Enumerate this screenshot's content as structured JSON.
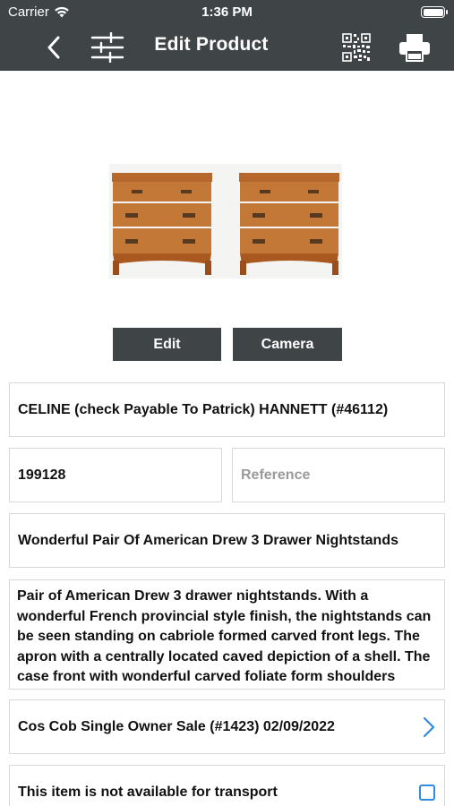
{
  "status_bar": {
    "carrier": "Carrier",
    "time": "1:36 PM",
    "battery_level": 1.0
  },
  "nav": {
    "title": "Edit Product",
    "back_icon": "chevron-left-icon",
    "filter_icon": "sliders-icon",
    "qr_icon": "qr-code-icon",
    "print_icon": "printer-icon"
  },
  "image": {
    "alt": "Pair of nightstands"
  },
  "buttons": {
    "edit": "Edit",
    "camera": "Camera"
  },
  "form": {
    "consignor": "CELINE (check Payable To Patrick) HANNETT (#46112)",
    "item_number": "199128",
    "reference_placeholder": "Reference",
    "title": "Wonderful Pair Of American Drew 3 Drawer Nightstands",
    "description": "Pair of American Drew 3 drawer nightstands.  With a wonderful French provincial style finish, the nightstands can be seen standing on cabriole formed carved front legs.  The apron with a centrally located caved depiction of a shell.  The case front with wonderful carved foliate form shoulders",
    "sale": "Cos Cob Single Owner Sale (#1423) 02/09/2022",
    "transport_label": "This item is not available for transport",
    "transport_checked": false
  },
  "colors": {
    "bar": "#3f4546",
    "accent": "#2e8be0",
    "border": "#d8d8d8"
  }
}
